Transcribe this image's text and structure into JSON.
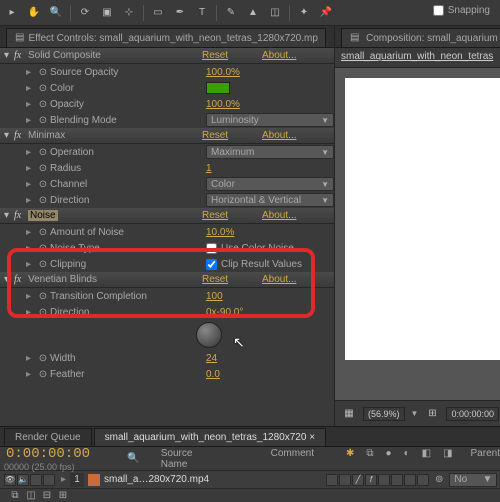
{
  "toolbar": {
    "snapping_label": "Snapping"
  },
  "effect_controls": {
    "tab_prefix": "Effect Controls: ",
    "tab_file": "small_aquarium_with_neon_tetras_1280x720.mp",
    "effects": [
      {
        "name": "Solid Composite",
        "reset": "Reset",
        "about": "About...",
        "props": [
          {
            "label": "Source Opacity",
            "value": "100.0%"
          },
          {
            "label": "Color",
            "swatch": "#3aa000"
          },
          {
            "label": "Opacity",
            "value": "100.0%"
          },
          {
            "label": "Blending Mode",
            "dropdown": "Luminosity"
          }
        ]
      },
      {
        "name": "Minimax",
        "reset": "Reset",
        "about": "About...",
        "props": [
          {
            "label": "Operation",
            "dropdown": "Maximum"
          },
          {
            "label": "Radius",
            "value": "1"
          },
          {
            "label": "Channel",
            "dropdown": "Color"
          },
          {
            "label": "Direction",
            "dropdown": "Horizontal & Vertical"
          }
        ]
      },
      {
        "name": "Noise",
        "reset": "Reset",
        "about": "About...",
        "selected": true,
        "props": [
          {
            "label": "Amount of Noise",
            "value": "10.0%"
          },
          {
            "label": "Noise Type",
            "checkbox": false,
            "cb_label": "Use Color Noise"
          },
          {
            "label": "Clipping",
            "checkbox": true,
            "cb_label": "Clip Result Values"
          }
        ]
      },
      {
        "name": "Venetian Blinds",
        "reset": "Reset",
        "about": "About...",
        "props": [
          {
            "label": "Transition Completion",
            "value": "100"
          },
          {
            "label": "Direction",
            "value": "0x-90.0°",
            "knob": true
          },
          {
            "label": "Width",
            "value": "24"
          },
          {
            "label": "Feather",
            "value": "0.0"
          }
        ]
      }
    ]
  },
  "composition": {
    "tab_prefix": "Composition: ",
    "tab_file": "small_aquarium",
    "subtab": "small_aquarium_with_neon_tetras",
    "zoom": "(56.9%)",
    "time": "0:00:00:00"
  },
  "timeline": {
    "tabs": [
      "Render Queue",
      "small_aquarium_with_neon_tetras_1280x720 ×"
    ],
    "timecode": "0:00:00:00",
    "fps": "00000 (25.00 fps)",
    "cols": {
      "source": "Source Name",
      "comment": "Comment",
      "parent": "Parent"
    },
    "layer": {
      "num": "1",
      "name": "small_a…280x720.mp4",
      "parent": "No"
    }
  }
}
